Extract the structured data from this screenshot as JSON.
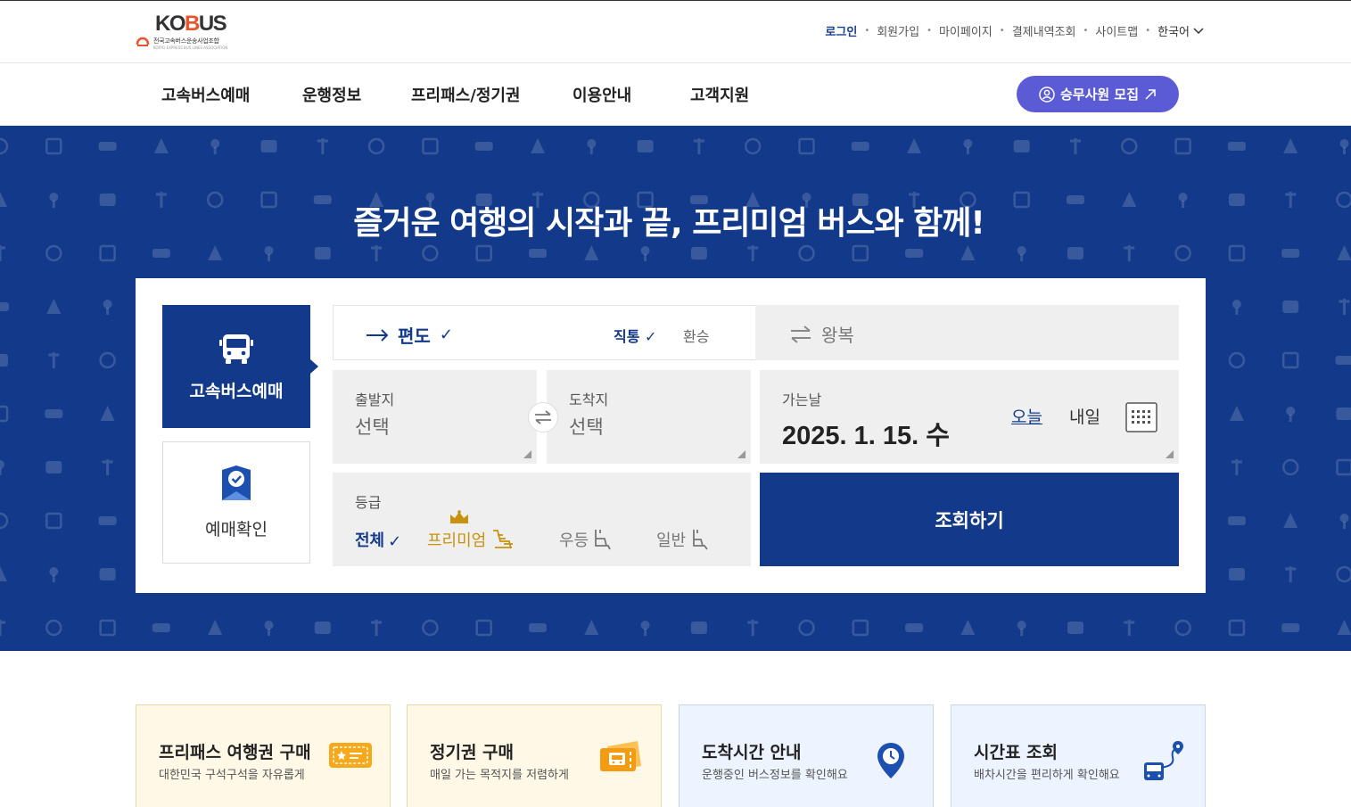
{
  "logo": {
    "main": "KOBUS",
    "sub": "전국고속버스운송사업조합",
    "sub_en": "KORYO EXPRESS BUS LINES ASSOCIATION"
  },
  "util_nav": {
    "login": "로그인",
    "signup": "회원가입",
    "mypage": "마이페이지",
    "payment_history": "결제내역조회",
    "sitemap": "사이트맵",
    "language": "한국어"
  },
  "gnb": {
    "items": [
      "고속버스예매",
      "운행정보",
      "프리패스/정기권",
      "이용안내",
      "고객지원"
    ],
    "recruit_button": "승무사원 모집"
  },
  "hero": {
    "title": "즐거운 여행의 시작과 끝, 프리미엄 버스와 함께!"
  },
  "booking": {
    "tab_reserve": "고속버스예매",
    "tab_confirm": "예매확인",
    "trip_oneway": "편도",
    "route_direct": "직통",
    "route_transfer": "환승",
    "trip_roundtrip": "왕복",
    "departure_label": "출발지",
    "departure_value": "선택",
    "arrival_label": "도착지",
    "arrival_value": "선택",
    "date_label": "가는날",
    "date_value": "2025. 1. 15. 수",
    "today": "오늘",
    "tomorrow": "내일",
    "grade_label": "등급",
    "grade_all": "전체",
    "grade_premium": "프리미엄",
    "grade_excellent": "우등",
    "grade_general": "일반",
    "search_button": "조회하기"
  },
  "quick_links": [
    {
      "title": "프리패스 여행권 구매",
      "subtitle": "대한민국 구석구석을 자유롭게"
    },
    {
      "title": "정기권 구매",
      "subtitle": "매일 가는 목적지를 저렴하게"
    },
    {
      "title": "도착시간 안내",
      "subtitle": "운행중인 버스정보를 확인해요"
    },
    {
      "title": "시간표 조회",
      "subtitle": "배차시간을 편리하게 확인해요"
    }
  ],
  "colors": {
    "primary_navy": "#133a8a",
    "recruit_purple": "#5b5bd6",
    "premium_gold": "#c8920e"
  }
}
